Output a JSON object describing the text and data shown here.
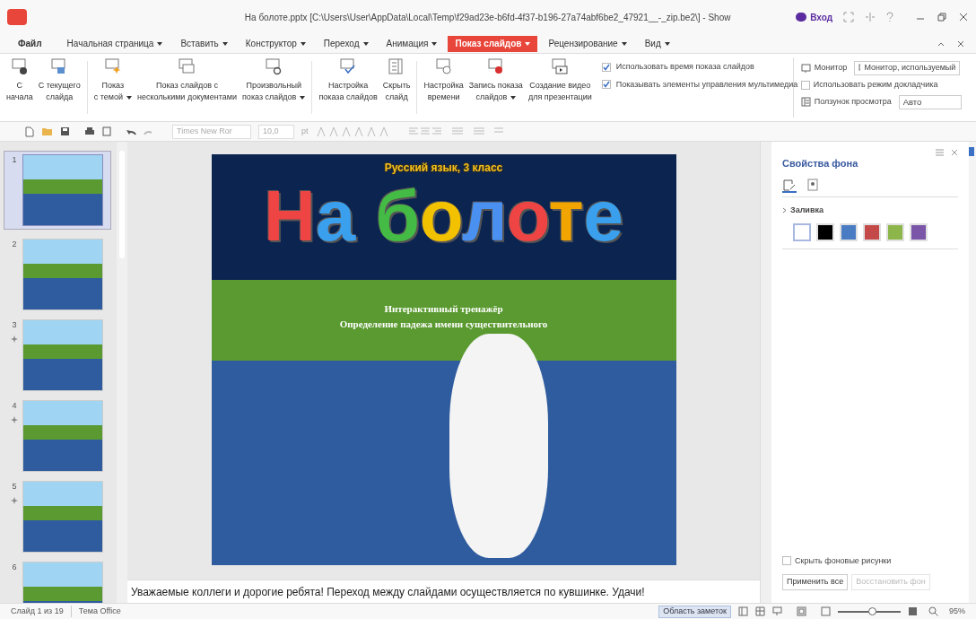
{
  "window": {
    "title": "На болоте.pptx [C:\\Users\\User\\AppData\\Local\\Temp\\f29ad23e-b6fd-4f37-b196-27a74abf6be2_47921__-_zip.be2\\] - Show",
    "login": "Вход"
  },
  "menu": [
    {
      "label": "Файл",
      "selected": false,
      "dropdown": false
    },
    {
      "label": "Начальная страница",
      "selected": false,
      "dropdown": true
    },
    {
      "label": "Вставить",
      "selected": false,
      "dropdown": true
    },
    {
      "label": "Конструктор",
      "selected": false,
      "dropdown": true
    },
    {
      "label": "Переход",
      "selected": false,
      "dropdown": true
    },
    {
      "label": "Анимация",
      "selected": false,
      "dropdown": true
    },
    {
      "label": "Показ слайдов",
      "selected": true,
      "dropdown": true
    },
    {
      "label": "Рецензирование",
      "selected": false,
      "dropdown": true
    },
    {
      "label": "Вид",
      "selected": false,
      "dropdown": true
    }
  ],
  "ribbon": [
    {
      "label": "С\nначала",
      "dropdown": false,
      "separator_before": false
    },
    {
      "label": "С текущего\nслайда",
      "dropdown": false,
      "separator_before": false
    },
    {
      "label": "Показ\nс темой",
      "dropdown": true,
      "separator_before": true
    },
    {
      "label": "Показ слайдов с\nнесколькими документами",
      "dropdown": false,
      "separator_before": false
    },
    {
      "label": "Произвольный\nпоказ слайдов",
      "dropdown": true,
      "separator_before": false
    },
    {
      "label": "Настройка\nпоказа слайдов",
      "dropdown": false,
      "separator_before": true
    },
    {
      "label": "Скрыть\nслайд",
      "dropdown": false,
      "separator_before": false
    },
    {
      "label": "Настройка\nвремени",
      "dropdown": false,
      "separator_before": true
    },
    {
      "label": "Запись показа\nслайдов",
      "dropdown": true,
      "separator_before": false
    },
    {
      "label": "Создание видео\nдля презентации",
      "dropdown": false,
      "separator_before": false
    }
  ],
  "options": [
    {
      "label": "Использовать время показа слайдов",
      "checked": true
    },
    {
      "label": "Показывать элементы управления мультимедиа",
      "checked": true
    }
  ],
  "monitor": {
    "label": "Монитор",
    "value": "Монитор, используемый"
  },
  "presenter_mode": {
    "label": "Использовать режим докладчика",
    "checked": false
  },
  "preview_slider": {
    "label": "Ползунок просмотра",
    "value": "Авто"
  },
  "toolbar": {
    "font": "Times New Ror",
    "size": "10,0",
    "unit": "pt"
  },
  "slides": [
    {
      "number": "1",
      "selected": true,
      "animated": false
    },
    {
      "number": "2",
      "selected": false,
      "animated": false
    },
    {
      "number": "3",
      "selected": false,
      "animated": true
    },
    {
      "number": "4",
      "selected": false,
      "animated": true
    },
    {
      "number": "5",
      "selected": false,
      "animated": true
    },
    {
      "number": "6",
      "selected": false,
      "animated": false
    }
  ],
  "slide": {
    "subject": "Русский язык, 3 класс",
    "title": "На болоте",
    "subtitle": "Интерактивный тренажёр",
    "topic": "Определение падежа имени существительного"
  },
  "notes": "Уважаемые коллеги и дорогие ребята! Переход между слайдами осуществляется по кувшинке. Удачи!",
  "pane": {
    "title": "Свойства фона",
    "section": "Заливка",
    "swatches": [
      {
        "color": "#ffffff",
        "selected": true
      },
      {
        "color": "#000000",
        "selected": false
      },
      {
        "color": "#4a7cc4",
        "selected": false
      },
      {
        "color": "#c44a4a",
        "selected": false
      },
      {
        "color": "#8db64a",
        "selected": false
      },
      {
        "color": "#7a55a8",
        "selected": false
      }
    ],
    "hide_graphics": {
      "label": "Скрыть фоновые рисунки",
      "checked": false
    },
    "apply_all": "Применить все",
    "restore": "Восстановить фон"
  },
  "status": {
    "slide": "Слайд 1 из 19",
    "theme": "Тема Office",
    "notes_button": "Область заметок",
    "zoom": "95%",
    "level": 0.55
  }
}
